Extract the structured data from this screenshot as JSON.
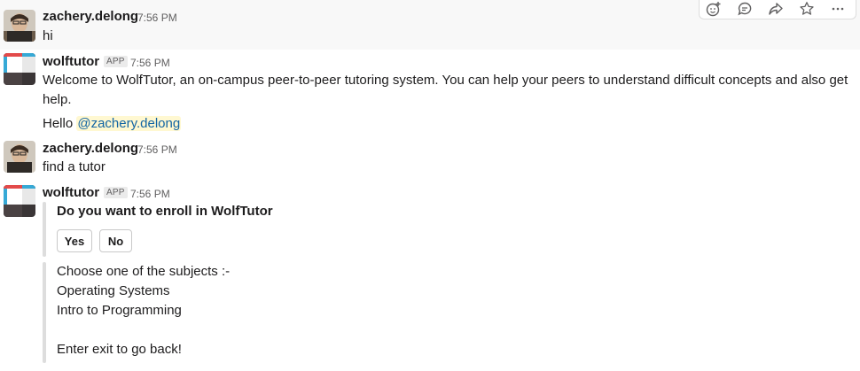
{
  "messages": [
    {
      "author": "zachery.delong",
      "time": "7:56 PM",
      "text": "hi"
    },
    {
      "author": "wolftutor",
      "badge": "APP",
      "time": "7:56 PM",
      "lines": [
        "Welcome to WolfTutor, an on-campus peer-to-peer tutoring system. You can help your peers to understand difficult concepts and also get",
        "help."
      ],
      "hello_prefix": "Hello ",
      "mention": "@zachery.delong"
    },
    {
      "author": "zachery.delong",
      "time": "7:56 PM",
      "text": "find a tutor"
    },
    {
      "author": "wolftutor",
      "badge": "APP",
      "time": "7:56 PM",
      "enroll_question": "Do you want to enroll in WolfTutor",
      "yes_label": "Yes",
      "no_label": "No",
      "subjects_lines": [
        "Choose one of the subjects :-",
        "Operating Systems",
        "Intro to Programming",
        "",
        "Enter exit to go back!"
      ]
    }
  ],
  "toolbar": {
    "icons": [
      "add-reaction-icon",
      "reply-thread-icon",
      "share-icon",
      "star-icon",
      "more-actions-icon"
    ]
  },
  "colors": {
    "mention": "#1264a3",
    "mention_bg": "#fff8d1",
    "hover_bg": "#f8f8f8",
    "timestamp": "#616061"
  }
}
